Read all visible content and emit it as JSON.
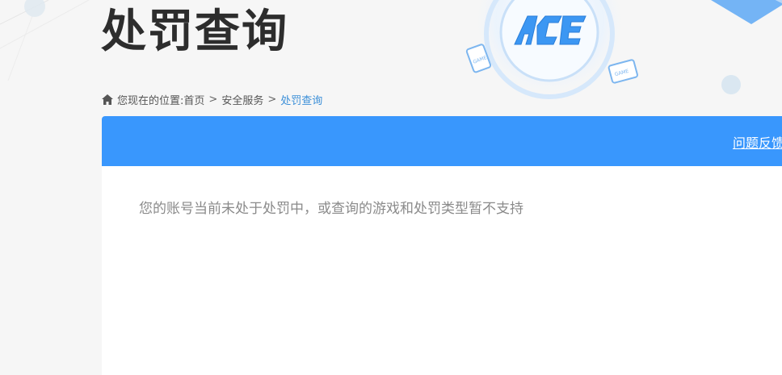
{
  "page": {
    "title": "处罚查询"
  },
  "breadcrumb": {
    "prefix": "您现在的位置:",
    "items": [
      "首页",
      "安全服务"
    ],
    "separator": ">",
    "current": "处罚查询"
  },
  "panel": {
    "header": {
      "feedback_link": "问题反馈"
    },
    "message": "您的账号当前未处于处罚中，或查询的游戏和处罚类型暂不支持"
  },
  "icons": {
    "home": "home-icon",
    "logo": "ace-logo"
  },
  "colors": {
    "accent": "#3997fd",
    "breadcrumb_current": "#3b8fd8",
    "title": "#2d2d2d",
    "message": "#8a8a8a"
  }
}
